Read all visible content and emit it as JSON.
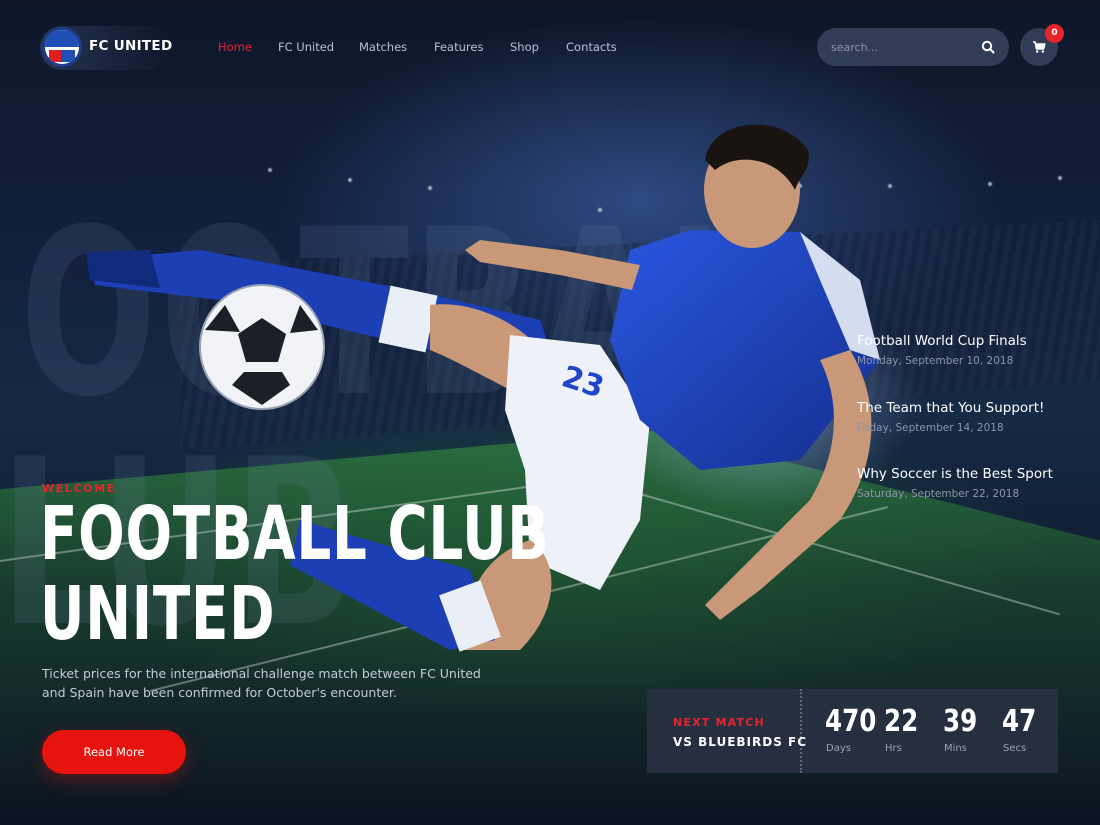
{
  "brand": {
    "name": "FC UNITED"
  },
  "nav": {
    "items": [
      {
        "label": "Home",
        "active": true
      },
      {
        "label": "FC United",
        "active": false
      },
      {
        "label": "Matches",
        "active": false
      },
      {
        "label": "Features",
        "active": false
      },
      {
        "label": "Shop",
        "active": false
      },
      {
        "label": "Contacts",
        "active": false
      }
    ]
  },
  "search": {
    "placeholder": "search..."
  },
  "cart": {
    "count": "0"
  },
  "hero": {
    "background_words": [
      "OOTBAL",
      "LUB"
    ],
    "welcome": "WELCOME",
    "title_line1": "FOOTBALL CLUB",
    "title_line2": "UNITED",
    "description": "Ticket prices for the international challenge match between FC United and Spain have been confirmed for October's encounter.",
    "read_more": "Read More",
    "jersey_number": "23"
  },
  "news": [
    {
      "title": "Football World Cup Finals",
      "date": "Monday, September 10, 2018"
    },
    {
      "title": "The Team that You Support!",
      "date": "Friday, September 14, 2018"
    },
    {
      "title": "Why Soccer is the Best Sport",
      "date": "Saturday, September 22, 2018"
    }
  ],
  "next_match": {
    "label": "NEXT MATCH",
    "opponent": "VS BLUEBIRDS FC",
    "countdown": [
      {
        "value": "470",
        "unit": "Days"
      },
      {
        "value": "22",
        "unit": "Hrs"
      },
      {
        "value": "39",
        "unit": "Mins"
      },
      {
        "value": "47",
        "unit": "Secs"
      }
    ]
  },
  "colors": {
    "accent": "#e6242b",
    "background": "#0d1426",
    "jersey": "#1f45c8"
  }
}
